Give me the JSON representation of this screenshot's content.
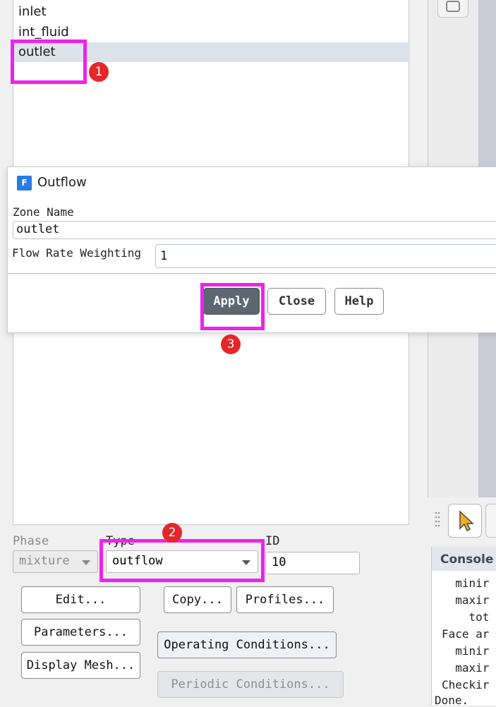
{
  "zone_list": {
    "items": [
      "inlet",
      "int_fluid",
      "outlet"
    ],
    "selected": "outlet"
  },
  "dialog": {
    "title": "Outflow",
    "icon_letter": "F",
    "zone_name_label": "Zone Name",
    "zone_name_value": "outlet",
    "flow_rate_label": "Flow Rate Weighting",
    "flow_rate_value": "1",
    "apply_label": "Apply",
    "close_label": "Close",
    "help_label": "Help"
  },
  "bottom": {
    "phase_label": "Phase",
    "phase_value": "mixture",
    "type_label": "Type",
    "type_value": "outflow",
    "id_label": "ID",
    "id_value": "10",
    "edit_label": "Edit...",
    "copy_label": "Copy...",
    "profiles_label": "Profiles...",
    "parameters_label": "Parameters...",
    "operating_label": "Operating Conditions...",
    "display_mesh_label": "Display Mesh...",
    "periodic_label": "Periodic Conditions..."
  },
  "console": {
    "header": "Console",
    "lines": [
      "  minir",
      "  maxir",
      "    tot",
      "Face ar",
      "  minir",
      "  maxir",
      "Checkir",
      "Done."
    ]
  },
  "annotations": {
    "steps": [
      "1",
      "2",
      "3"
    ],
    "highlight_color": "#ee22ee",
    "badge_color": "#e5262a"
  }
}
